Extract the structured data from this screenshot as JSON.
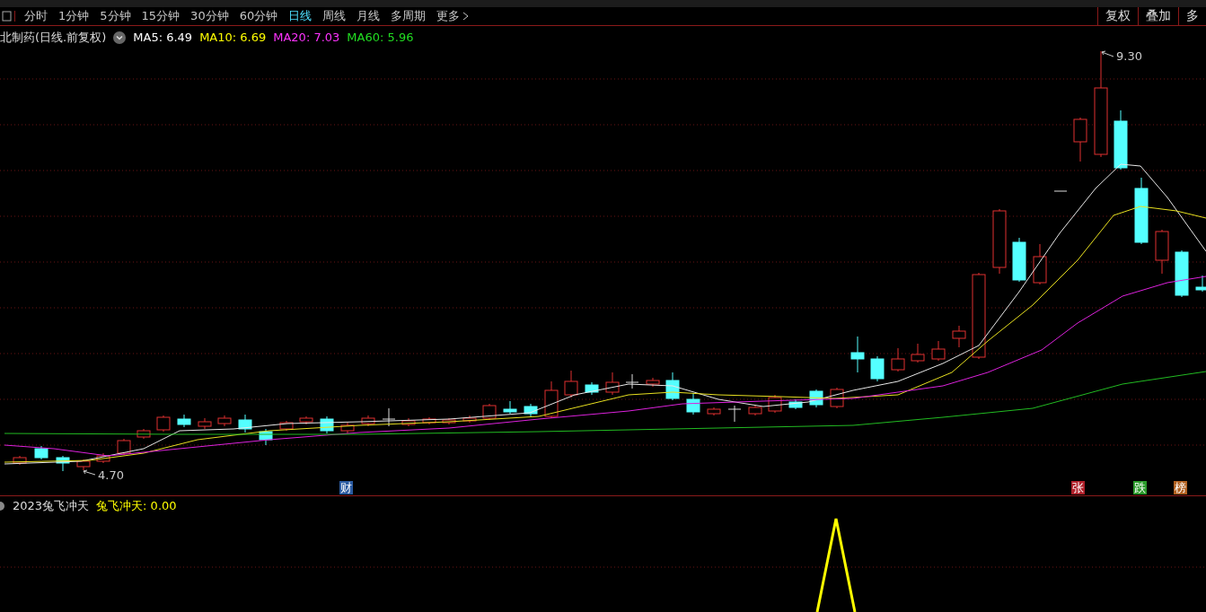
{
  "toolbar": {
    "tabs": [
      {
        "label": "分时",
        "selected": false
      },
      {
        "label": "1分钟",
        "selected": false
      },
      {
        "label": "5分钟",
        "selected": false
      },
      {
        "label": "15分钟",
        "selected": false
      },
      {
        "label": "30分钟",
        "selected": false
      },
      {
        "label": "60分钟",
        "selected": false
      },
      {
        "label": "日线",
        "selected": true
      },
      {
        "label": "周线",
        "selected": false
      },
      {
        "label": "月线",
        "selected": false
      },
      {
        "label": "多周期",
        "selected": false
      },
      {
        "label": "更多",
        "selected": false
      }
    ],
    "buttons": [
      "复权",
      "叠加",
      "多"
    ]
  },
  "price_chart": {
    "title": "北制药(日线.前复权)",
    "indicators": [
      {
        "label": "MA5: 6.49",
        "color": "#ffffff"
      },
      {
        "label": "MA10: 6.69",
        "color": "#ffff00"
      },
      {
        "label": "MA20: 7.03",
        "color": "#ff33ff"
      },
      {
        "label": "MA60: 5.96",
        "color": "#22dd22"
      }
    ],
    "high_label": "9.30",
    "low_label": "4.70",
    "markers": [
      {
        "text": "财",
        "color": "#2a5aa0"
      },
      {
        "text": "张",
        "color": "#b0202a"
      },
      {
        "text": "跌",
        "color": "#2a9a2a"
      },
      {
        "text": "榜",
        "color": "#b06020"
      }
    ]
  },
  "indicator_panel": {
    "name": "2023兔飞冲天",
    "value_label": "兔飞冲天: 0.00"
  }
}
